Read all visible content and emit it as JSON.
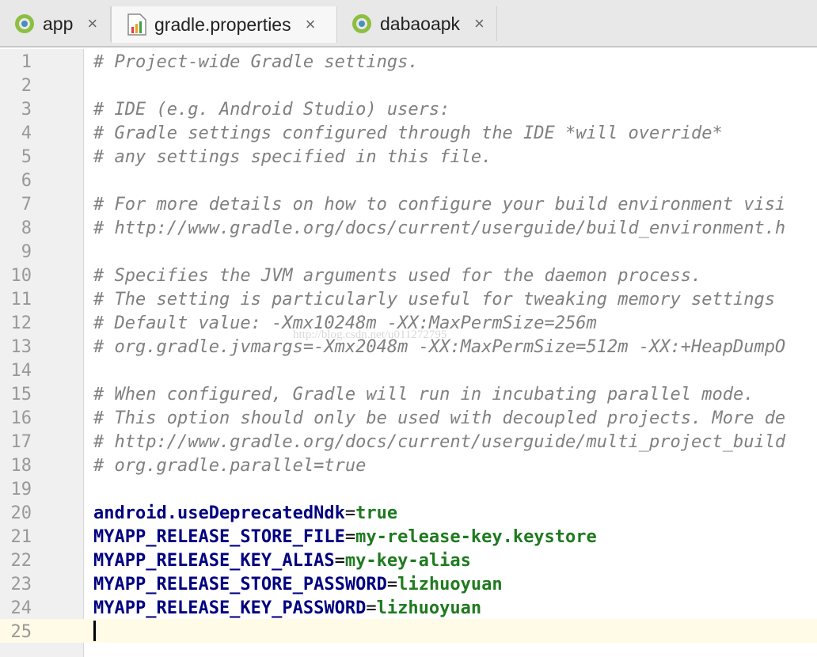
{
  "tabs": [
    {
      "label": "app",
      "icon": "android-module-icon",
      "active": false
    },
    {
      "label": "gradle.properties",
      "icon": "properties-file-icon",
      "active": true
    },
    {
      "label": "dabaoapk",
      "icon": "android-module-icon",
      "active": false
    }
  ],
  "close_glyph": "×",
  "lines": [
    {
      "n": "1",
      "type": "comment",
      "text": "# Project-wide Gradle settings."
    },
    {
      "n": "2",
      "type": "blank",
      "text": ""
    },
    {
      "n": "3",
      "type": "comment",
      "text": "# IDE (e.g. Android Studio) users:"
    },
    {
      "n": "4",
      "type": "comment",
      "text": "# Gradle settings configured through the IDE *will override*"
    },
    {
      "n": "5",
      "type": "comment",
      "text": "# any settings specified in this file."
    },
    {
      "n": "6",
      "type": "blank",
      "text": ""
    },
    {
      "n": "7",
      "type": "comment",
      "text": "# For more details on how to configure your build environment visi"
    },
    {
      "n": "8",
      "type": "comment",
      "text": "# http://www.gradle.org/docs/current/userguide/build_environment.h"
    },
    {
      "n": "9",
      "type": "blank",
      "text": ""
    },
    {
      "n": "10",
      "type": "comment",
      "text": "# Specifies the JVM arguments used for the daemon process."
    },
    {
      "n": "11",
      "type": "comment",
      "text": "# The setting is particularly useful for tweaking memory settings"
    },
    {
      "n": "12",
      "type": "comment",
      "text": "# Default value: -Xmx10248m -XX:MaxPermSize=256m"
    },
    {
      "n": "13",
      "type": "comment",
      "text": "# org.gradle.jvmargs=-Xmx2048m -XX:MaxPermSize=512m -XX:+HeapDumpO"
    },
    {
      "n": "14",
      "type": "blank",
      "text": ""
    },
    {
      "n": "15",
      "type": "comment",
      "text": "# When configured, Gradle will run in incubating parallel mode."
    },
    {
      "n": "16",
      "type": "comment",
      "text": "# This option should only be used with decoupled projects. More de"
    },
    {
      "n": "17",
      "type": "comment",
      "text": "# http://www.gradle.org/docs/current/userguide/multi_project_build"
    },
    {
      "n": "18",
      "type": "comment",
      "text": "# org.gradle.parallel=true"
    },
    {
      "n": "19",
      "type": "blank",
      "text": ""
    },
    {
      "n": "20",
      "type": "prop",
      "key": "android.useDeprecatedNdk",
      "value": "true"
    },
    {
      "n": "21",
      "type": "prop",
      "key": "MYAPP_RELEASE_STORE_FILE",
      "value": "my-release-key.keystore"
    },
    {
      "n": "22",
      "type": "prop",
      "key": "MYAPP_RELEASE_KEY_ALIAS",
      "value": "my-key-alias"
    },
    {
      "n": "23",
      "type": "prop",
      "key": "MYAPP_RELEASE_STORE_PASSWORD",
      "value": "lizhuoyuan"
    },
    {
      "n": "24",
      "type": "prop",
      "key": "MYAPP_RELEASE_KEY_PASSWORD",
      "value": "lizhuoyuan"
    },
    {
      "n": "25",
      "type": "blank",
      "text": ""
    }
  ],
  "watermark": "http://blog.csdn.net/u011272795",
  "colors": {
    "comment": "#808080",
    "key": "#000080",
    "value": "#1f7a1f",
    "caret_line": "#fffbe6"
  }
}
